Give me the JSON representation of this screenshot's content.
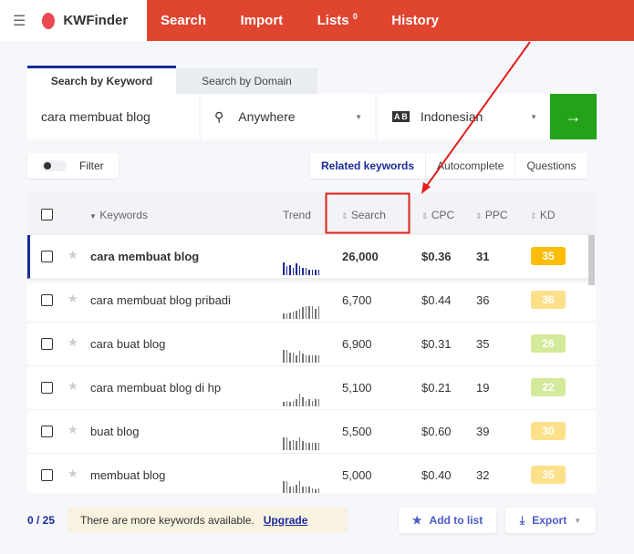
{
  "header": {
    "menu_icon": "hamburger-icon",
    "app_name": "KWFinder",
    "nav": [
      {
        "label": "Search"
      },
      {
        "label": "Import"
      },
      {
        "label": "Lists",
        "badge": "0"
      },
      {
        "label": "History"
      }
    ],
    "color": "#e0452f"
  },
  "search": {
    "tabs": [
      "Search by Keyword",
      "Search by Domain"
    ],
    "keyword": "cara membuat blog",
    "location": "Anywhere",
    "language": "Indonesian",
    "go_icon": "arrow-right-icon"
  },
  "filter": {
    "label": "Filter"
  },
  "modes": [
    "Related keywords",
    "Autocomplete",
    "Questions"
  ],
  "table": {
    "headers": {
      "keywords": "Keywords",
      "trend": "Trend",
      "search": "Search",
      "cpc": "CPC",
      "ppc": "PPC",
      "kd": "KD"
    },
    "rows": [
      {
        "keyword": "cara membuat blog",
        "trend": [
          0.9,
          0.6,
          0.7,
          0.5,
          0.8,
          0.6,
          0.5,
          0.5,
          0.4,
          0.4,
          0.4,
          0.4
        ],
        "search": "26,000",
        "cpc": "$0.36",
        "ppc": "31",
        "kd": "35",
        "kd_color": "#fbbd08"
      },
      {
        "keyword": "cara membuat blog pribadi",
        "trend": [
          0.4,
          0.4,
          0.45,
          0.5,
          0.55,
          0.7,
          0.8,
          0.9,
          0.9,
          0.9,
          0.7,
          0.9
        ],
        "search": "6,700",
        "cpc": "$0.44",
        "ppc": "36",
        "kd": "36",
        "kd_color": "#fde08a"
      },
      {
        "keyword": "cara buat blog",
        "trend": [
          0.9,
          0.9,
          0.7,
          0.7,
          0.5,
          0.8,
          0.6,
          0.5,
          0.5,
          0.5,
          0.5,
          0.5
        ],
        "search": "6,900",
        "cpc": "$0.31",
        "ppc": "35",
        "kd": "26",
        "kd_color": "#d4ea9a"
      },
      {
        "keyword": "cara membuat blog di hp",
        "trend": [
          0.3,
          0.4,
          0.3,
          0.4,
          0.5,
          0.9,
          0.6,
          0.4,
          0.5,
          0.4,
          0.5,
          0.5
        ],
        "search": "5,100",
        "cpc": "$0.21",
        "ppc": "19",
        "kd": "22",
        "kd_color": "#d4ea9a"
      },
      {
        "keyword": "buat blog",
        "trend": [
          0.9,
          0.9,
          0.6,
          0.7,
          0.6,
          0.9,
          0.6,
          0.5,
          0.5,
          0.5,
          0.5,
          0.5
        ],
        "search": "5,500",
        "cpc": "$0.60",
        "ppc": "39",
        "kd": "30",
        "kd_color": "#fde08a"
      },
      {
        "keyword": "membuat blog",
        "trend": [
          0.9,
          0.9,
          0.5,
          0.5,
          0.6,
          0.9,
          0.5,
          0.5,
          0.5,
          0.4,
          0.3,
          0.4
        ],
        "search": "5,000",
        "cpc": "$0.40",
        "ppc": "32",
        "kd": "35",
        "kd_color": "#fde08a"
      }
    ]
  },
  "footer": {
    "count": "0 / 25",
    "notice": "There are more keywords available.",
    "upgrade": "Upgrade",
    "add_to_list": "Add to list",
    "export": "Export"
  }
}
